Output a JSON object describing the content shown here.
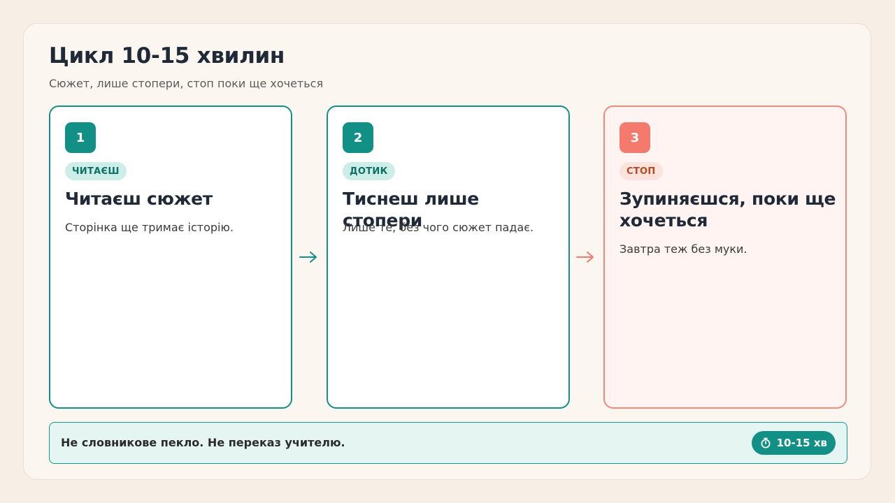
{
  "header": {
    "title": "Цикл 10-15 хвилин",
    "subtitle": "Сюжет, лише стопери, стоп поки ще хочеться"
  },
  "steps": [
    {
      "number": "1",
      "tag": "ЧИТАЄШ",
      "title": "Читаєш сюжет",
      "text": "Сторінка ще тримає історію."
    },
    {
      "number": "2",
      "tag": "ДОТИК",
      "title": "Тиснеш лише стопери",
      "text": "Лише те, без чого сюжет падає."
    },
    {
      "number": "3",
      "tag": "СТОП",
      "title": "Зупиняєшся, поки ще хочеться",
      "text": "Завтра теж без муки."
    }
  ],
  "footer": {
    "text": "Не словникове пекло. Не переказ учителю.",
    "badge": "10-15 хв",
    "badge_icon": "timer-icon"
  },
  "colors": {
    "teal": "#139086",
    "coral": "#f47a6d",
    "background": "#f7efe6"
  }
}
